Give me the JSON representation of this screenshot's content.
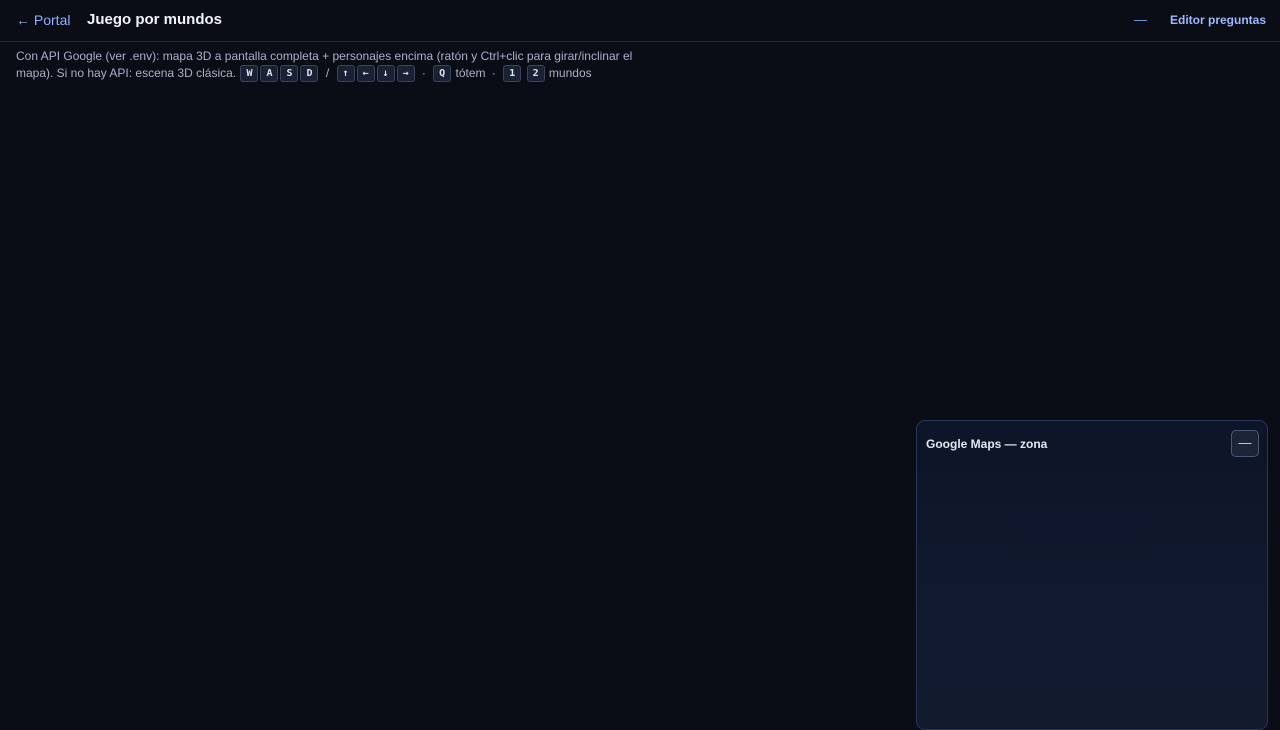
{
  "header": {
    "back_label": "← Portal",
    "title": "Juego por mundos",
    "minimize_label": "—",
    "editor_label": "Editor preguntas"
  },
  "help": {
    "line1": "Con API Google (ver .env): mapa 3D a pantalla completa + personajes encima (ratón y Ctrl+clic para girar/inclinar el",
    "line2_prefix": "mapa). Si no hay API: escena 3D clásica.",
    "keys_wasd": [
      "W",
      "A",
      "S",
      "D"
    ],
    "slash": "/",
    "keys_arrows": [
      "↑",
      "←",
      "↓",
      "→"
    ],
    "dot": "·",
    "key_totem": "Q",
    "totem_label": "tótem",
    "keys_worlds": [
      "1",
      "2"
    ],
    "worlds_label": "mundos"
  },
  "map_panel": {
    "title": "Google Maps — zona",
    "minimize_label": "—"
  },
  "colors": {
    "background": "#0a0d16",
    "accent": "#8fb0ff",
    "panel": "#0f1529"
  }
}
